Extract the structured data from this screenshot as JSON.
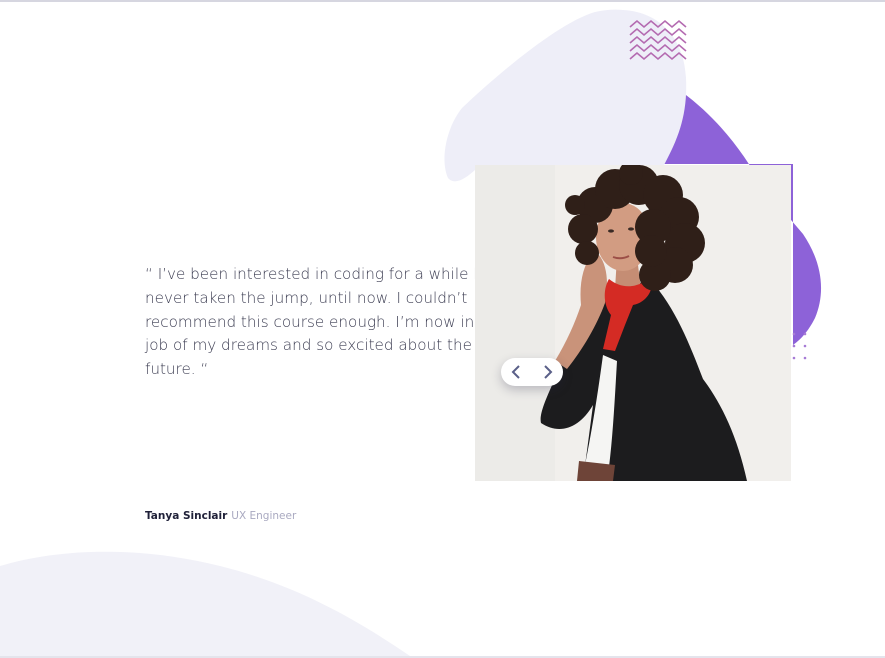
{
  "testimonial": {
    "quote": "“ I’ve been interested in coding for a while but never taken the jump, until now. I couldn’t recommend this course enough. I’m now in the job of my dreams and so excited about the future. “",
    "author_name": "Tanya Sinclair",
    "author_role": "UX Engineer"
  },
  "slider": {
    "prev_icon": "chevron-left-icon",
    "next_icon": "chevron-right-icon"
  },
  "colors": {
    "accent_purple": "#8d62d8",
    "blob_light": "#eeeef8",
    "quote_text": "#3c3d52",
    "author_name": "#1f2038",
    "author_role": "#a9a9c0",
    "zigzag": "#b46bb1"
  }
}
